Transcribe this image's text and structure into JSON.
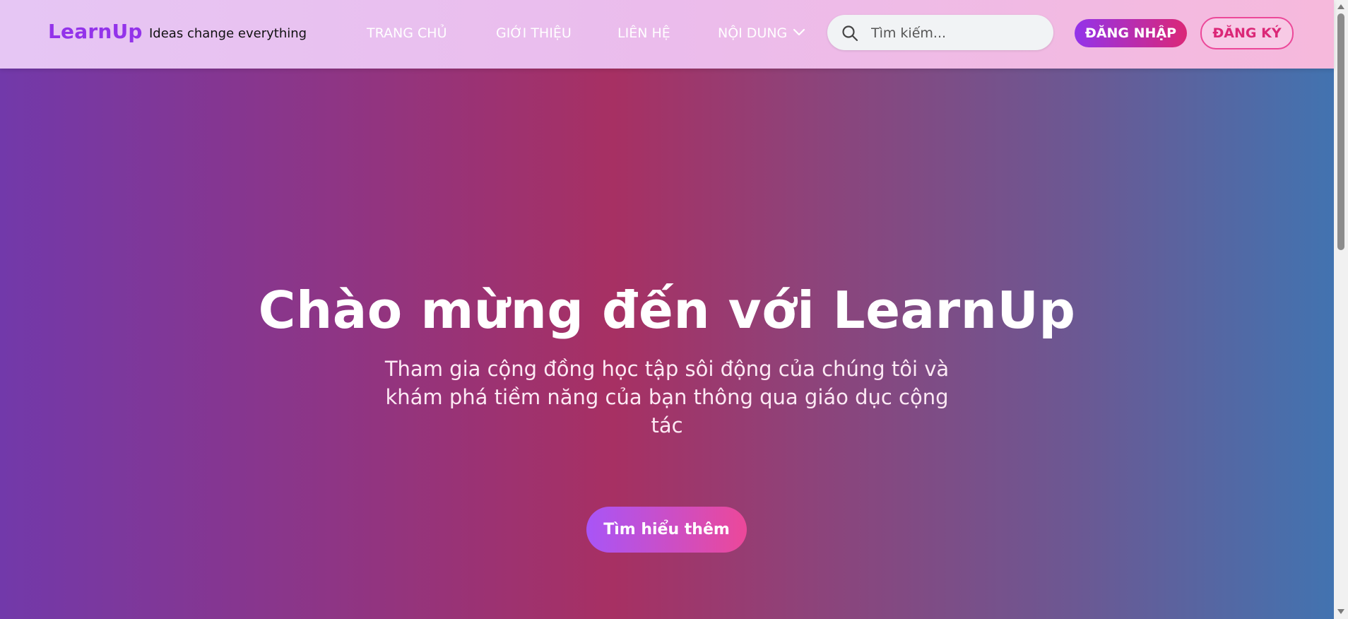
{
  "header": {
    "logo": "LearnUp",
    "tagline": "Ideas change everything",
    "nav": {
      "home": "TRANG CHỦ",
      "about": "GIỚI THIỆU",
      "contact": "LIÊN HỆ",
      "content": "NỘI DUNG"
    },
    "search": {
      "placeholder": "Tìm kiếm...",
      "icon": "search-icon"
    },
    "login_label": "ĐĂNG NHẬP",
    "register_label": "ĐĂNG KÝ"
  },
  "hero": {
    "title": "Chào mừng đến với LearnUp",
    "subtitle": "Tham gia cộng đồng học tập sôi động của chúng tôi và khám phá tiềm năng của bạn thông qua giáo dục cộng tác",
    "cta_label": "Tìm hiểu thêm"
  },
  "colors": {
    "brand": "#9333ea",
    "accent": "#db2777",
    "hero_start": "#7239aa",
    "hero_mid": "#a73063",
    "hero_end": "#4273b0"
  }
}
